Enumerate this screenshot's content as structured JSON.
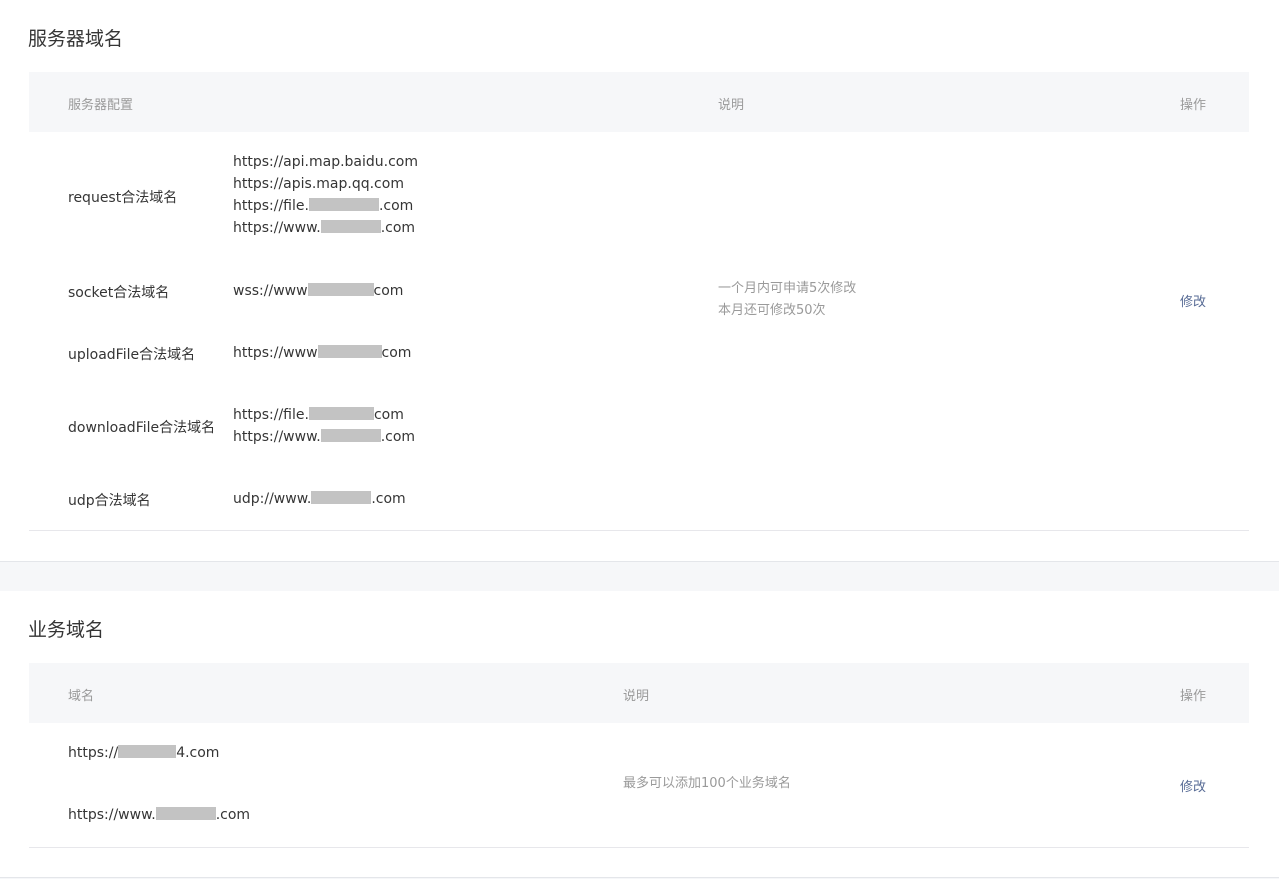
{
  "server_domains": {
    "title": "服务器域名",
    "headers": {
      "config": "服务器配置",
      "note": "说明",
      "action": "操作"
    },
    "rows": [
      {
        "label": "request合法域名",
        "domains": [
          {
            "pre": "https://api.map.baidu.com",
            "post": ""
          },
          {
            "pre": "https://apis.map.qq.com",
            "post": ""
          },
          {
            "pre": "https://file.",
            "post": ".com"
          },
          {
            "pre": "https://www.",
            "post": ".com"
          }
        ]
      },
      {
        "label": "socket合法域名",
        "domains": [
          {
            "pre": "wss://www",
            "post": "com"
          }
        ]
      },
      {
        "label": "uploadFile合法域名",
        "domains": [
          {
            "pre": "https://www",
            "post": "com"
          }
        ]
      },
      {
        "label": "downloadFile合法域名",
        "domains": [
          {
            "pre": "https://file.",
            "post": "com"
          },
          {
            "pre": "https://www.",
            "post": ".com"
          }
        ]
      },
      {
        "label": "udp合法域名",
        "domains": [
          {
            "pre": "udp://www.",
            "post": ".com"
          }
        ]
      }
    ],
    "note_lines": [
      "一个月内可申请5次修改",
      "本月还可修改50次"
    ],
    "action": "修改"
  },
  "business_domains": {
    "title": "业务域名",
    "headers": {
      "domain": "域名",
      "note": "说明",
      "action": "操作"
    },
    "domains": [
      {
        "pre": "https://",
        "post": "4.com"
      },
      {
        "pre": "https://www.",
        "post": ".com"
      }
    ],
    "note": "最多可以添加100个业务域名",
    "action": "修改"
  },
  "colors": {
    "link": "#576b95",
    "muted": "#9a9a9a",
    "header_bg": "#f6f7f9",
    "redaction": "#c3c3c3"
  }
}
